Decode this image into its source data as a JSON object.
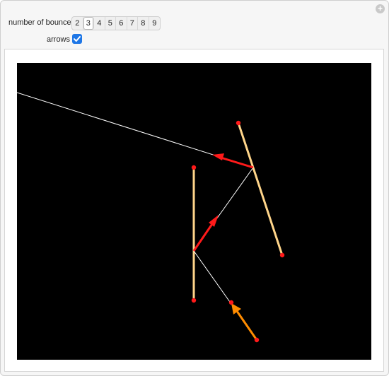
{
  "controls": {
    "bounces_label": "number of bounces",
    "bounce_options": [
      "2",
      "3",
      "4",
      "5",
      "6",
      "7",
      "8",
      "9"
    ],
    "selected_bounces": "3",
    "arrows_label": "arrows",
    "arrows_checked": true
  },
  "colors": {
    "mirror": "#ffd58a",
    "endpoint": "#ff1a1a",
    "ray": "#ffffff",
    "direction_arrow": "#ff1a1a",
    "initial_arrow": "#ff8c00",
    "background": "#000000",
    "checkbox_accent": "#1f77e6"
  },
  "icons": {
    "plus_button": "plus-icon",
    "checkbox": "check-icon"
  }
}
